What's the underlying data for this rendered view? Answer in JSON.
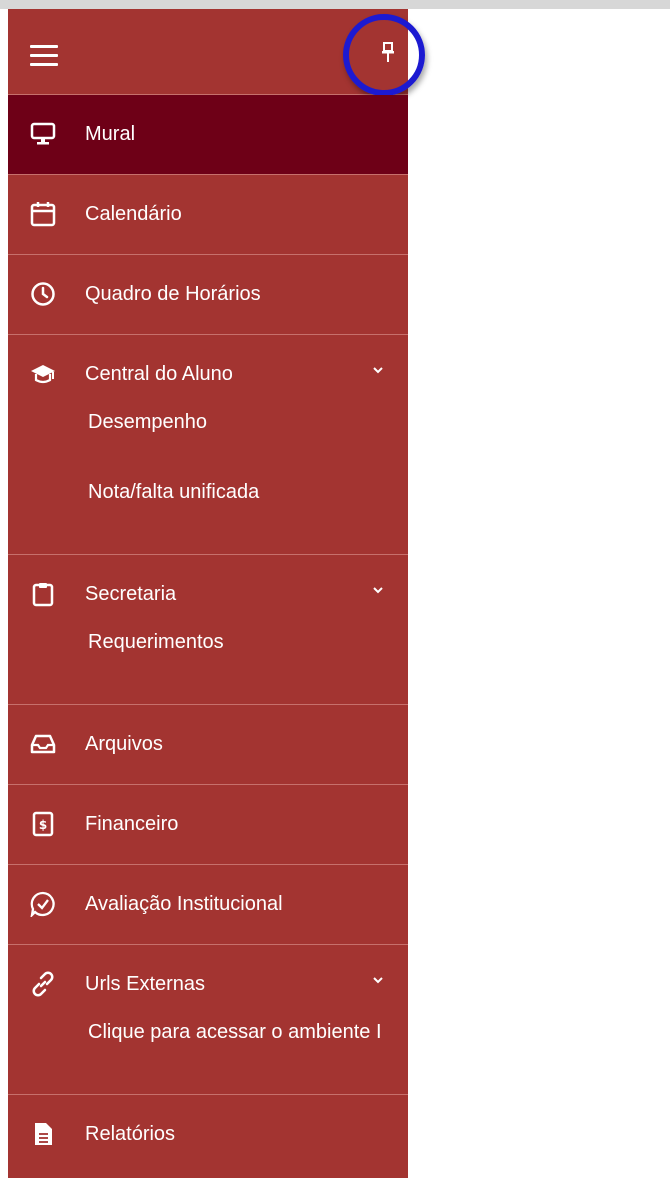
{
  "menu": {
    "items": [
      {
        "label": "Mural"
      },
      {
        "label": "Calendário"
      },
      {
        "label": "Quadro de Horários"
      },
      {
        "label": "Central do Aluno",
        "subitems": [
          {
            "label": "Desempenho"
          },
          {
            "label": "Nota/falta unificada"
          }
        ]
      },
      {
        "label": "Secretaria",
        "subitems": [
          {
            "label": "Requerimentos"
          }
        ]
      },
      {
        "label": "Arquivos"
      },
      {
        "label": "Financeiro"
      },
      {
        "label": "Avaliação Institucional"
      },
      {
        "label": "Urls Externas",
        "subitems": [
          {
            "label": "Clique para acessar o ambiente I"
          }
        ]
      },
      {
        "label": "Relatórios"
      }
    ]
  },
  "colors": {
    "sidebar": "#a33431",
    "active": "#6e0017",
    "highlight": "#1c1ad1"
  }
}
